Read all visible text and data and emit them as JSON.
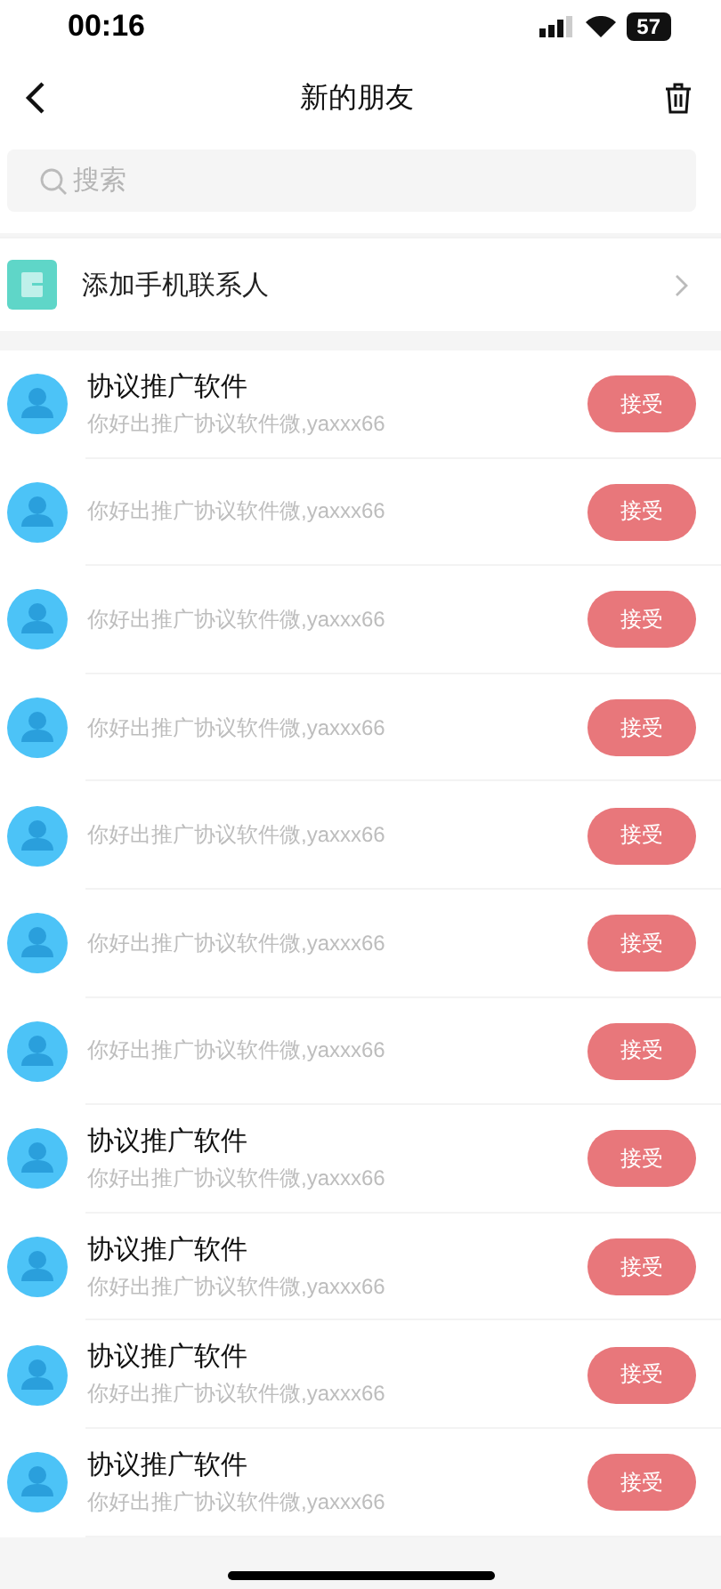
{
  "status_bar": {
    "time": "00:16",
    "battery": "57"
  },
  "nav": {
    "title": "新的朋友"
  },
  "search": {
    "placeholder": "搜索"
  },
  "add_contacts": {
    "label": "添加手机联系人"
  },
  "requests": [
    {
      "name": "协议推广软件",
      "message": "你好出推广协议软件微,yaxxx66",
      "button": "接受"
    },
    {
      "message": "你好出推广协议软件微,yaxxx66",
      "button": "接受"
    },
    {
      "message": "你好出推广协议软件微,yaxxx66",
      "button": "接受"
    },
    {
      "message": "你好出推广协议软件微,yaxxx66",
      "button": "接受"
    },
    {
      "message": "你好出推广协议软件微,yaxxx66",
      "button": "接受"
    },
    {
      "message": "你好出推广协议软件微,yaxxx66",
      "button": "接受"
    },
    {
      "message": "你好出推广协议软件微,yaxxx66",
      "button": "接受"
    },
    {
      "name": "协议推广软件",
      "message": "你好出推广协议软件微,yaxxx66",
      "button": "接受"
    },
    {
      "name": "协议推广软件",
      "message": "你好出推广协议软件微,yaxxx66",
      "button": "接受"
    },
    {
      "name": "协议推广软件",
      "message": "你好出推广协议软件微,yaxxx66",
      "button": "接受"
    },
    {
      "name": "协议推广软件",
      "message": "你好出推广协议软件微,yaxxx66",
      "button": "接受"
    }
  ]
}
